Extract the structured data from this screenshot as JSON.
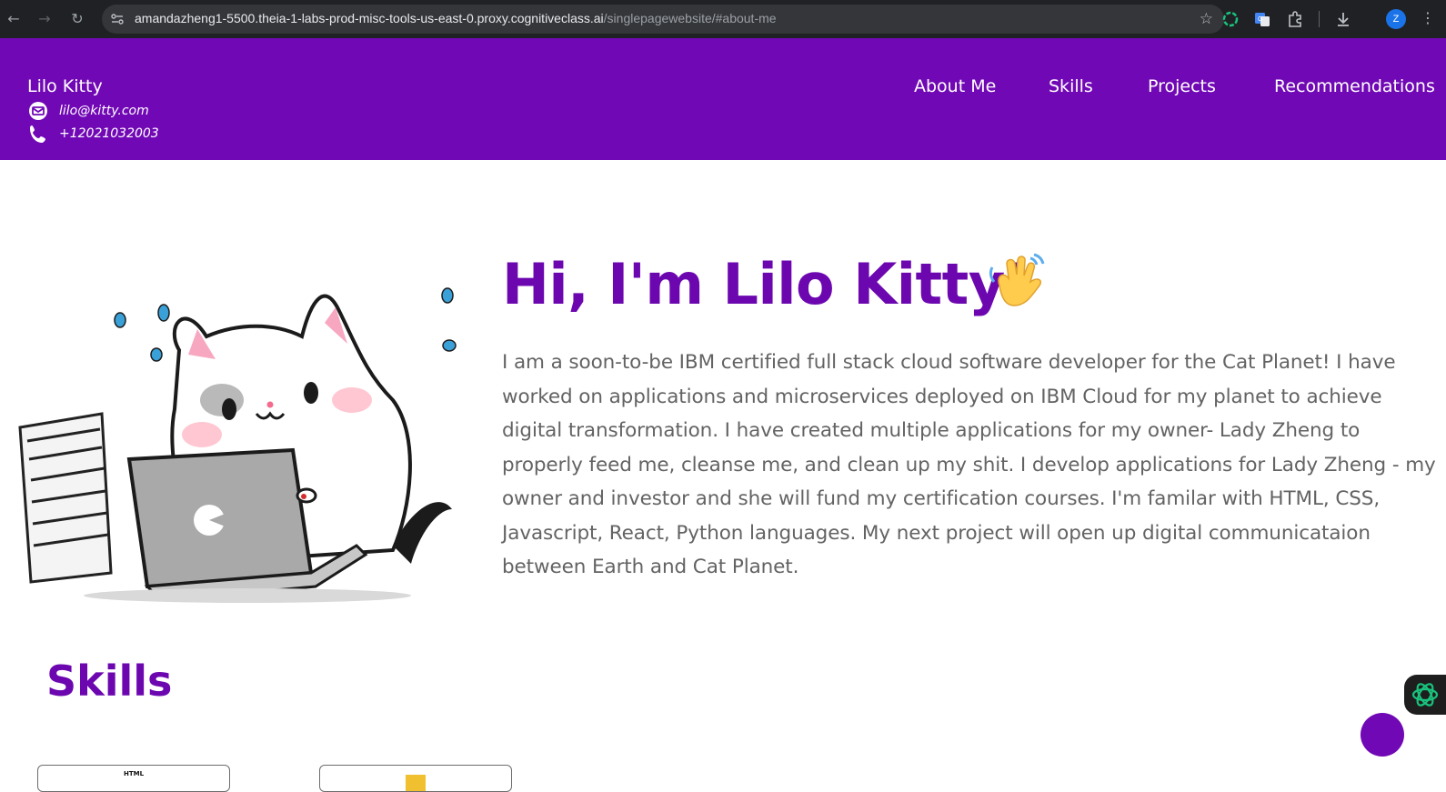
{
  "browser": {
    "url_host": "amandazheng1-5500.theia-1-labs-prod-misc-tools-us-east-0.proxy.cognitiveclass.ai",
    "url_path": "/singlepagewebsite/#about-me",
    "profile_initial": "Z"
  },
  "header": {
    "brand": "Lilo Kitty",
    "email": "lilo@kitty.com",
    "phone": "+12021032003",
    "nav": [
      "About Me",
      "Skills",
      "Projects",
      "Recommendations"
    ],
    "background_color": "#7108b5"
  },
  "hero": {
    "title": "Hi, I'm Lilo Kitty!",
    "wave_emoji": "waving-hand-icon",
    "bio": "I am a soon-to-be IBM certified full stack cloud software developer for the Cat Planet! I have worked on applications and microservices deployed on IBM Cloud for my planet to achieve digital transformation. I have created multiple applications for my owner- Lady Zheng to properly feed me, cleanse me, and clean up my shit. I develop applications for Lady Zheng - my owner and investor and she will fund my certification courses. I'm familar with HTML, CSS, Javascript, React, Python languages. My next project will open up digital communicataion between Earth and Cat Planet.",
    "title_color": "#6c07b0",
    "text_color": "#636363"
  },
  "skills": {
    "title": "Skills",
    "cards": [
      {
        "label": "HTML"
      },
      {
        "label": ""
      }
    ]
  }
}
